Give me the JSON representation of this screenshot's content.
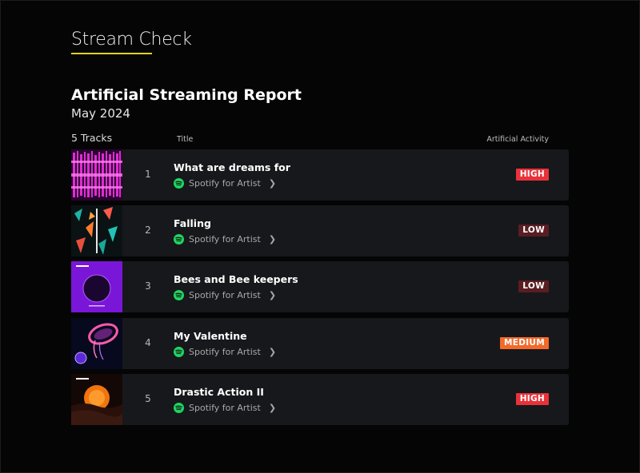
{
  "brand": {
    "name": "Stream Check",
    "accent": "#e0d21a"
  },
  "report": {
    "title": "Artificial Streaming Report",
    "date": "May 2024"
  },
  "table": {
    "count_label": "5 Tracks",
    "col_title": "Title",
    "col_activity": "Artificial Activity"
  },
  "tracks": [
    {
      "num": "1",
      "title": "What are dreams for",
      "link": "Spotify for Artist",
      "activity": "HIGH",
      "badge_color": "#e8323a"
    },
    {
      "num": "2",
      "title": "Falling",
      "link": "Spotify for Artist",
      "activity": "LOW",
      "badge_color": "#5a1d22"
    },
    {
      "num": "3",
      "title": "Bees and Bee keepers",
      "link": "Spotify for Artist",
      "activity": "LOW",
      "badge_color": "#5a1d22"
    },
    {
      "num": "4",
      "title": "My Valentine",
      "link": "Spotify for Artist",
      "activity": "MEDIUM",
      "badge_color": "#f26a2b"
    },
    {
      "num": "5",
      "title": "Drastic Action II",
      "link": "Spotify for Artist",
      "activity": "HIGH",
      "badge_color": "#e8323a"
    }
  ],
  "icons": {
    "link_icon": "spotify-icon",
    "chevron": "chevron-right-icon"
  },
  "spotify_color": "#1ed760"
}
